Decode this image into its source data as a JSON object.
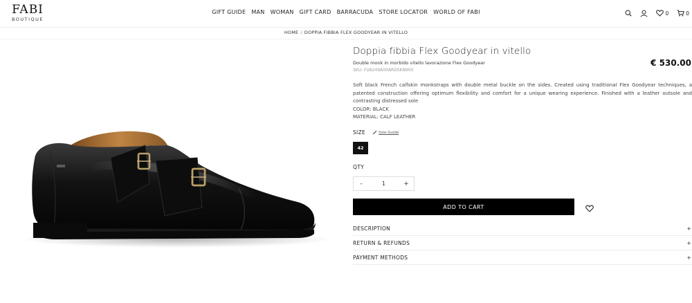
{
  "header": {
    "logo_main": "FABI",
    "logo_sub": "BOUTIQUE",
    "nav": [
      "GIFT GUIDE",
      "MAN",
      "WOMAN",
      "GIFT CARD",
      "BARRACUDA",
      "STORE LOCATOR",
      "WORLD OF FABI"
    ],
    "icons": {
      "search": "search-icon",
      "account": "user-icon",
      "wishlist": "heart-icon",
      "cart": "cart-icon"
    },
    "wishlist_count": "0",
    "cart_count": "0"
  },
  "breadcrumb": {
    "home": "HOME",
    "separator": "/",
    "current": "DOPPIA FIBBIA FLEX GOODYEAR IN VITELLO"
  },
  "product": {
    "title": "Doppia fibbia Flex Goodyear in vitello",
    "price": "€ 530.00",
    "subtitle": "Double monk in morbido vitello lavorazione Flex Goodyear",
    "sku": "SKU: FU8249A00ARDSKN900",
    "description": "Soft black French calfskin monkstraps with double metal buckle on the sides. Created using traditional Flex Goodyear techniques, a patented construction offering optimum flexibility and comfort for a unique wearing experience. Finished with a leather outsole and contrasting distressed sole",
    "color": "COLOR: BLACK",
    "material": "MATERIAL: CALF LEATHER",
    "image_alt": "black double monk strap shoe"
  },
  "size": {
    "label": "SIZE",
    "guide_label": "Size Guide",
    "selected": "42"
  },
  "quantity": {
    "label": "QTY",
    "minus": "-",
    "value": "1",
    "plus": "+"
  },
  "actions": {
    "add_to_cart": "ADD TO CART"
  },
  "accordion": [
    {
      "label": "DESCRIPTION",
      "icon": "+"
    },
    {
      "label": "RETURN & REFUNDS",
      "icon": "+"
    },
    {
      "label": "PAYMENT METHODS",
      "icon": "+"
    }
  ],
  "colors": {
    "accent": "#000000",
    "text": "#222222",
    "muted": "#9a9a9a",
    "divider": "#ececec"
  }
}
